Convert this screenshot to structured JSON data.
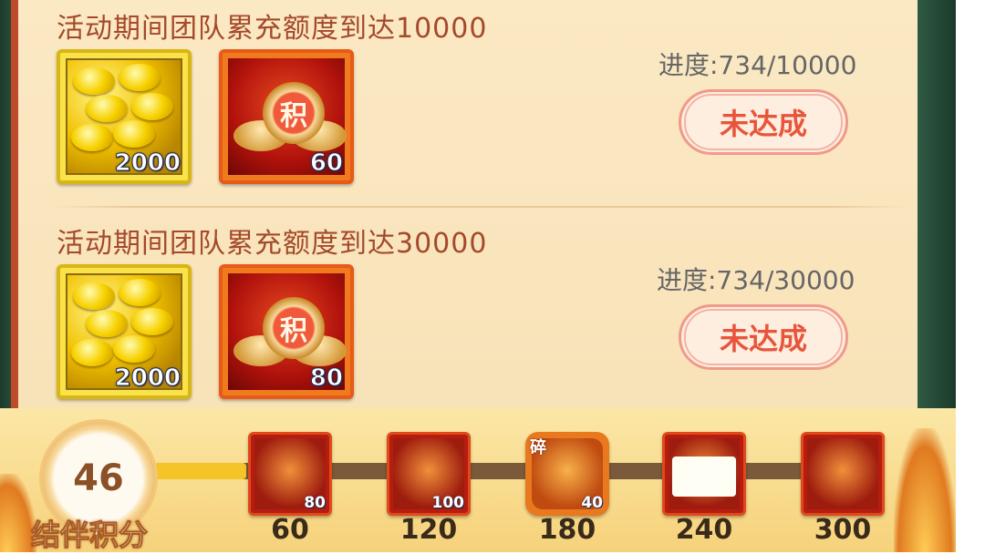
{
  "tasks": [
    {
      "title": "活动期间团队累充额度到达10000",
      "progress": "进度:734/10000",
      "button": "未达成",
      "rewards": [
        {
          "icon": "gold-ingot-icon",
          "qty": "2000"
        },
        {
          "icon": "points-badge-icon",
          "badge_char": "积",
          "qty": "60"
        }
      ]
    },
    {
      "title": "活动期间团队累充额度到达30000",
      "progress": "进度:734/30000",
      "button": "未达成",
      "rewards": [
        {
          "icon": "gold-ingot-icon",
          "qty": "2000"
        },
        {
          "icon": "points-badge-icon",
          "badge_char": "积",
          "qty": "80"
        }
      ]
    }
  ],
  "score": {
    "value": "46",
    "label": "结伴积分",
    "fill_fraction": 0.125
  },
  "milestones": [
    {
      "threshold": "60",
      "qty": "80",
      "icon": "armor-chest-icon"
    },
    {
      "threshold": "120",
      "qty": "100",
      "icon": "card-box-icon"
    },
    {
      "threshold": "180",
      "qty": "40",
      "icon": "weapon-shard-icon",
      "tag": "碎"
    },
    {
      "threshold": "240",
      "qty": "",
      "icon": "blank-card-icon"
    },
    {
      "threshold": "300",
      "qty": "",
      "icon": "character-portrait-icon"
    }
  ]
}
